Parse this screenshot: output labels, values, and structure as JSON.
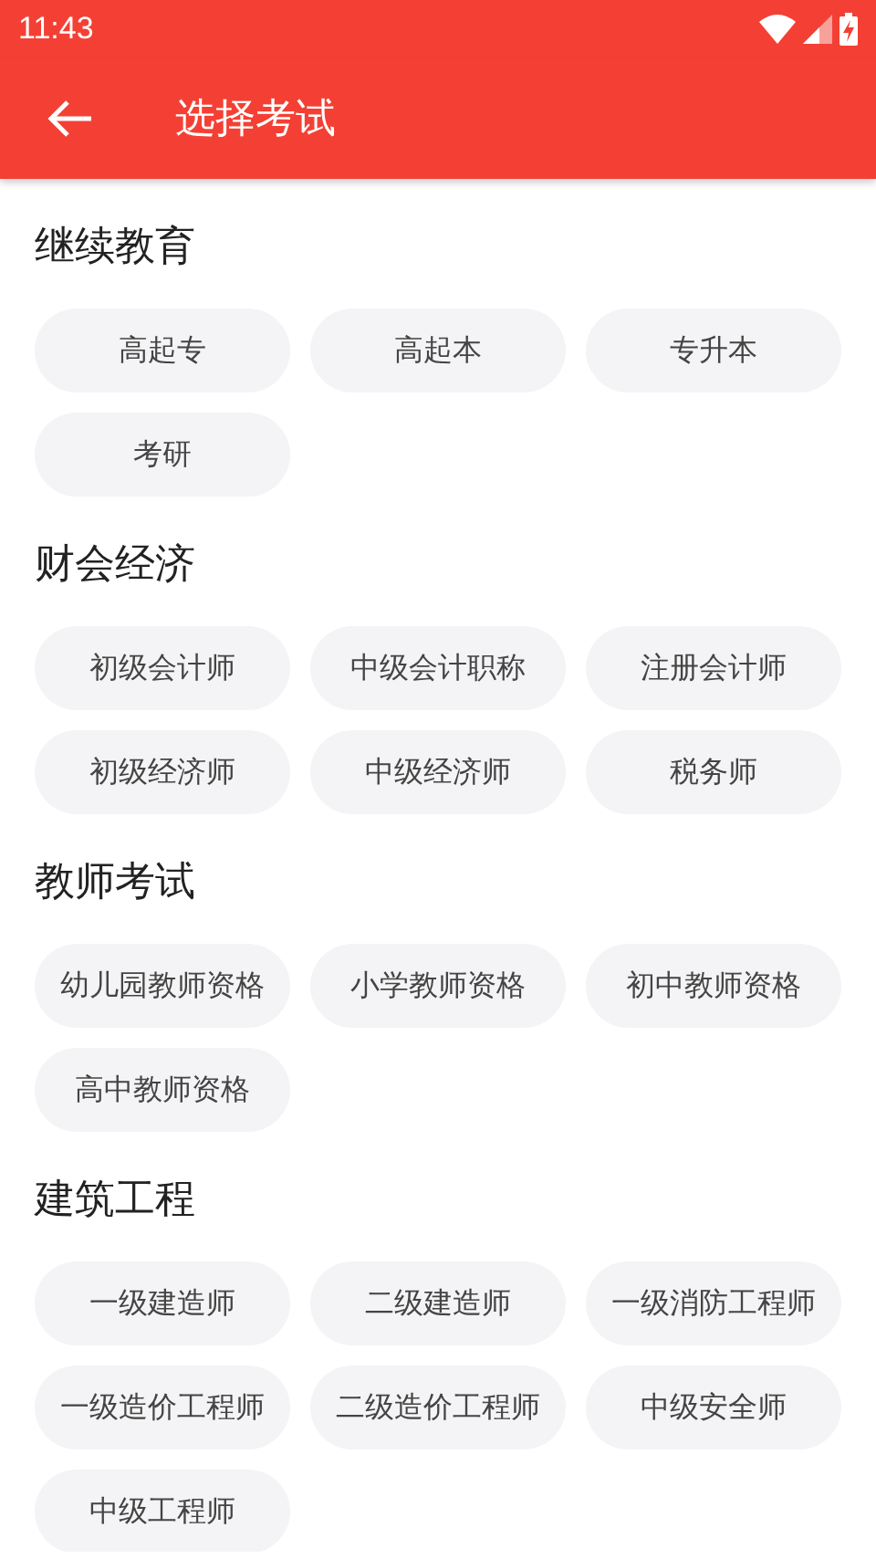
{
  "status_bar": {
    "time": "11:43"
  },
  "toolbar": {
    "title": "选择考试"
  },
  "sections": [
    {
      "title": "继续教育",
      "items": [
        "高起专",
        "高起本",
        "专升本",
        "考研"
      ]
    },
    {
      "title": "财会经济",
      "items": [
        "初级会计师",
        "中级会计职称",
        "注册会计师",
        "初级经济师",
        "中级经济师",
        "税务师"
      ]
    },
    {
      "title": "教师考试",
      "items": [
        "幼儿园教师资格",
        "小学教师资格",
        "初中教师资格",
        "高中教师资格"
      ]
    },
    {
      "title": "建筑工程",
      "items": [
        "一级建造师",
        "二级建造师",
        "一级消防工程师",
        "一级造价工程师",
        "二级造价工程师",
        "中级安全师",
        "中级工程师"
      ]
    }
  ]
}
